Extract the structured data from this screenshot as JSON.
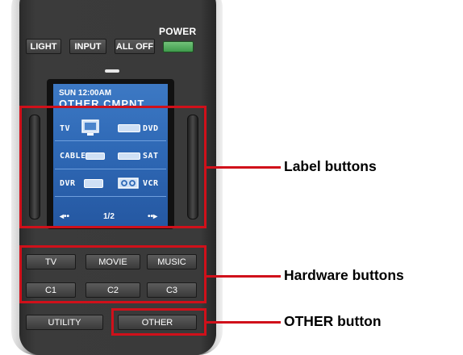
{
  "remote": {
    "power_label": "POWER",
    "top_buttons": [
      "LIGHT",
      "INPUT",
      "ALL OFF"
    ],
    "led_color": "#e8e8e8",
    "power_button_color": "#5fb368"
  },
  "lcd": {
    "time": "SUN 12:00AM",
    "title": "OTHER CMPNT",
    "labels": {
      "tv": "TV",
      "dvd": "DVD",
      "cable": "CABLE",
      "sat": "SAT",
      "dvr": "DVR",
      "vcr": "VCR"
    },
    "page_indicator": "1/2",
    "nav_left": "◂••",
    "nav_right": "••▸",
    "background_color": "#2f69b6"
  },
  "hardware_buttons": {
    "row1": [
      "TV",
      "MOVIE",
      "MUSIC"
    ],
    "row2": [
      "C1",
      "C2",
      "C3"
    ],
    "row3": [
      "UTILITY",
      "OTHER"
    ]
  },
  "callouts": {
    "label_buttons": "Label buttons",
    "hardware_buttons": "Hardware buttons",
    "other_button": "OTHER button",
    "color": "#d0101a"
  }
}
